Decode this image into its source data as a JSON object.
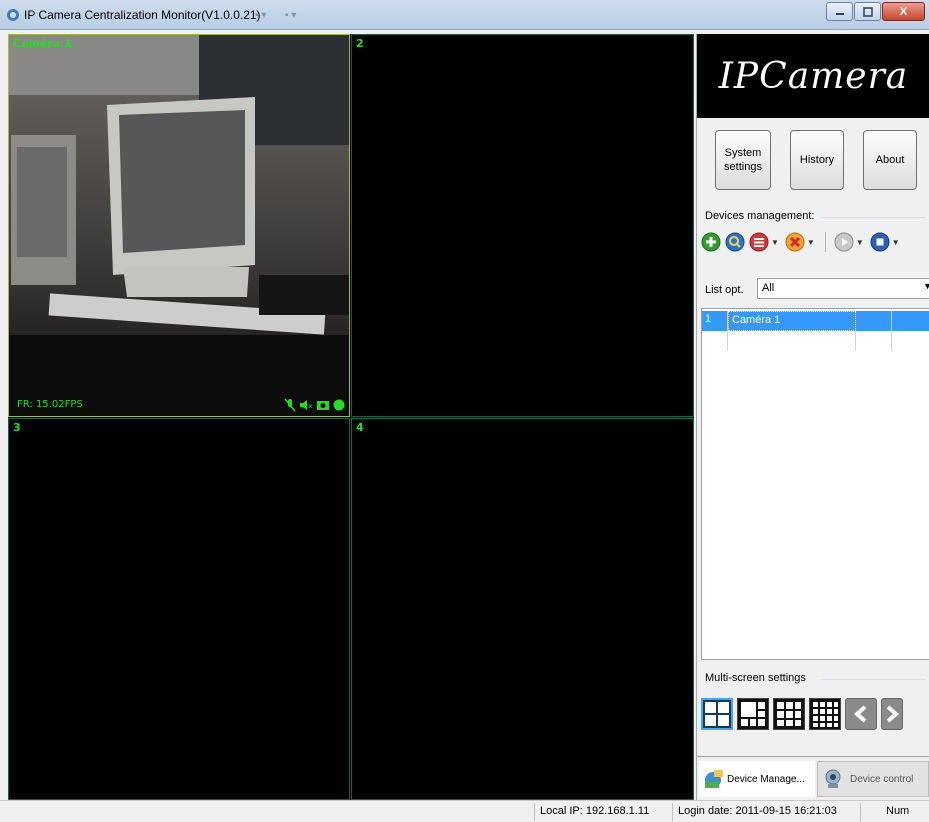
{
  "window": {
    "title": "IP Camera Centralization Monitor(V1.0.0.21)",
    "minimize_icon": "minimize-icon",
    "maximize_icon": "maximize-icon",
    "close_label": "X"
  },
  "video": {
    "tiles": [
      {
        "label": "Caméra 1",
        "fps": "FR: 15.02FPS",
        "selected": true
      },
      {
        "label": "2"
      },
      {
        "label": "3"
      },
      {
        "label": "4"
      }
    ]
  },
  "panel": {
    "logo_text": "IPCamera",
    "buttons": {
      "system_settings_line1": "System",
      "system_settings_line2": "settings",
      "history": "History",
      "about": "About"
    },
    "devices_management_label": "Devices management:",
    "list_opt_label": "List opt.",
    "list_opt_value": "All",
    "devices": [
      {
        "index": "1",
        "name": "Caméra 1"
      }
    ],
    "multiscreen_label": "Multi-screen settings",
    "tabs": {
      "device_manage": "Device Manage...",
      "device_control": "Device control"
    }
  },
  "statusbar": {
    "local_ip": "Local IP: 192.168.1.11",
    "login_date": "Login date: 2011-09-15 16:21:03",
    "num": "Num"
  },
  "colors": {
    "osd_green": "#21e021",
    "selection_blue": "#3399ff"
  }
}
